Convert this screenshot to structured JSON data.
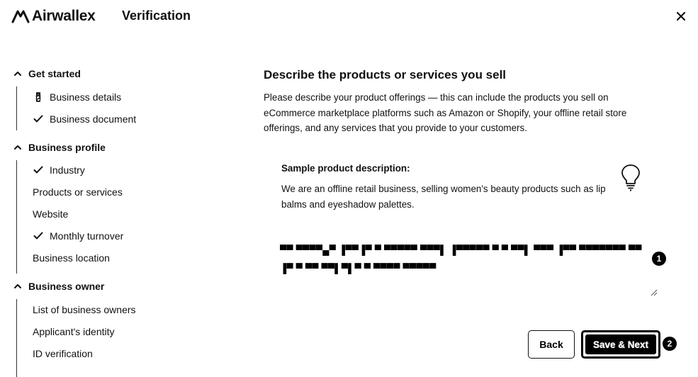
{
  "header": {
    "brand": "Airwallex",
    "title": "Verification"
  },
  "sidebar": {
    "sections": [
      {
        "label": "Get started",
        "items": [
          {
            "label": "Business details",
            "icon": "hourglass-icon"
          },
          {
            "label": "Business document",
            "icon": "check-icon"
          }
        ]
      },
      {
        "label": "Business profile",
        "items": [
          {
            "label": "Industry",
            "icon": "check-icon"
          },
          {
            "label": "Products or services",
            "icon": ""
          },
          {
            "label": "Website",
            "icon": ""
          },
          {
            "label": "Monthly turnover",
            "icon": "check-icon"
          },
          {
            "label": "Business location",
            "icon": ""
          }
        ]
      },
      {
        "label": "Business owner",
        "items": [
          {
            "label": "List of business owners",
            "icon": ""
          },
          {
            "label": "Applicant's identity",
            "icon": ""
          },
          {
            "label": "ID verification",
            "icon": ""
          }
        ]
      }
    ]
  },
  "main": {
    "heading": "Describe the products or services you sell",
    "description": "Please describe your product offerings — this can include the products you sell on eCommerce marketplace platforms such as Amazon or Shopify, your offline retail store offerings, and any services that you provide to your customers.",
    "sample_label": "Sample product description:",
    "sample_text": "We are an offline retail business, selling women's beauty products such as lip balms and eyeshadow palettes.",
    "textarea_value": "▀▀ ▀▀▀▀▄▀ ▐▀▀▐▀ ▀ ▀▀▀▀▀ ▀▀▀▌ ▐▀▀▀▀▀ ▀ ▀ ▀▀▌ ▀▀▀ ▐▀▀ ▀▀▀▀▀▀▀ ▀▀ ▐▀ ▀ ▀▀ ▀▀▌▀▌▀ ▀ ▀▀▀▀ ▀▀▀▀▀",
    "annotations": [
      "1",
      "2"
    ]
  },
  "buttons": {
    "back": "Back",
    "next": "Save & Next"
  }
}
